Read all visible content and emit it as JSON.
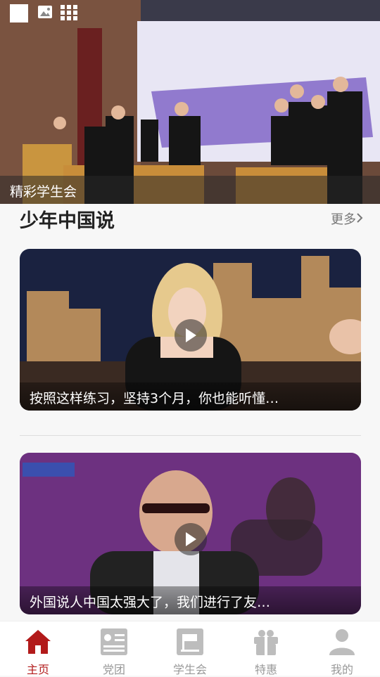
{
  "status_bar": {
    "right_text": "",
    "icons": [
      "white-square-icon",
      "image-icon",
      "grid-icon"
    ]
  },
  "banner": {
    "caption": "精彩学生会"
  },
  "section": {
    "title": "少年中国说",
    "more_label": "更多"
  },
  "videos": [
    {
      "title": "按照这样练习，坚持3个月，你也能听懂…"
    },
    {
      "title": "外国说人中国太强大了，我们进行了友…"
    }
  ],
  "bottom_nav": {
    "items": [
      {
        "label": "主页",
        "icon": "home-icon",
        "active": true
      },
      {
        "label": "党团",
        "icon": "party-icon",
        "active": false
      },
      {
        "label": "学生会",
        "icon": "student-union-icon",
        "active": false
      },
      {
        "label": "特惠",
        "icon": "gift-icon",
        "active": false
      },
      {
        "label": "我的",
        "icon": "profile-icon",
        "active": false
      }
    ]
  },
  "colors": {
    "accent": "#b21a1a",
    "inactive": "#999999"
  }
}
